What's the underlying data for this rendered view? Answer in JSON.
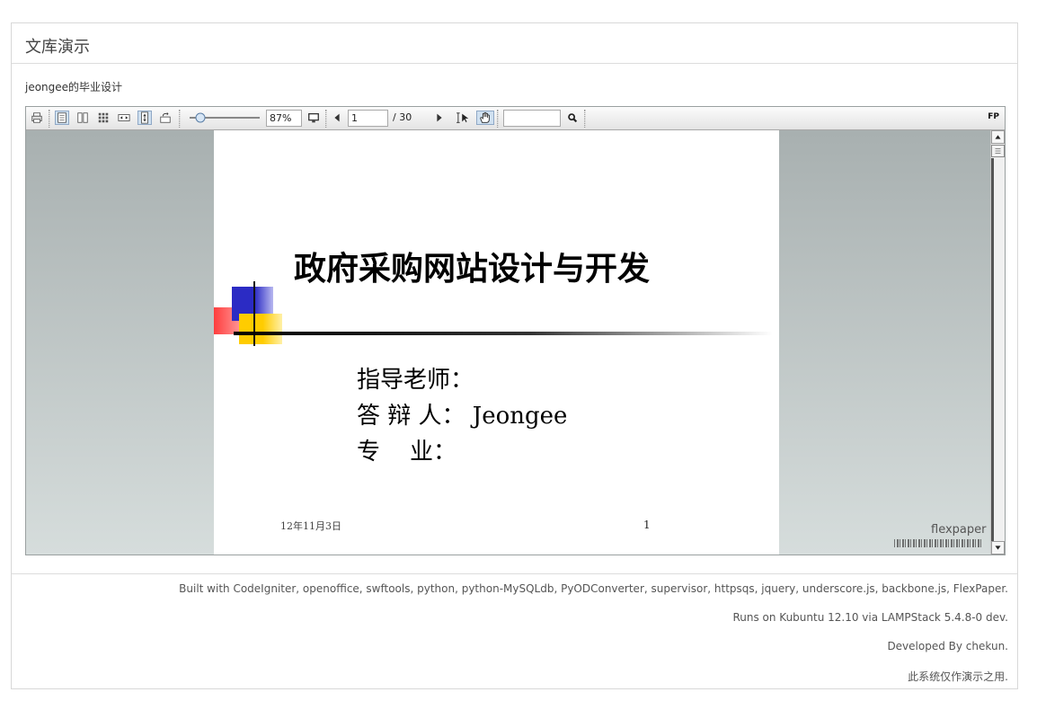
{
  "panel": {
    "title": "文库演示"
  },
  "document": {
    "name": "jeongee的毕业设计"
  },
  "toolbar": {
    "zoom": "87%",
    "page_current": "1",
    "page_total": "/ 30",
    "search_value": "",
    "brand": "FP",
    "icons": [
      "print-icon",
      "single-page-icon",
      "two-page-icon",
      "thumbnails-icon",
      "fit-width-icon",
      "fit-height-icon",
      "rotate-icon",
      "zoom-slider",
      "fullscreen-icon",
      "prev-page-icon",
      "next-page-icon",
      "text-select-icon",
      "hand-tool-icon",
      "search-icon"
    ]
  },
  "slide": {
    "title": "政府采购网站设计与开发",
    "lines": [
      "指导老师：",
      "答 辩 人： Jeongee",
      "专    业："
    ],
    "date": "12年11月3日",
    "page_number": "1"
  },
  "viewer": {
    "watermark": "flexpaper"
  },
  "footer": {
    "built_with": "Built with CodeIgniter, openoffice, swftools, python, python-MySQLdb, PyODConverter, supervisor, httpsqs, jquery, underscore.js, backbone.js, FlexPaper.",
    "runs_on": "Runs on Kubuntu 12.10 via LAMPStack 5.4.8-0 dev.",
    "developed_by": "Developed By chekun.",
    "notice": "此系统仅作演示之用."
  }
}
